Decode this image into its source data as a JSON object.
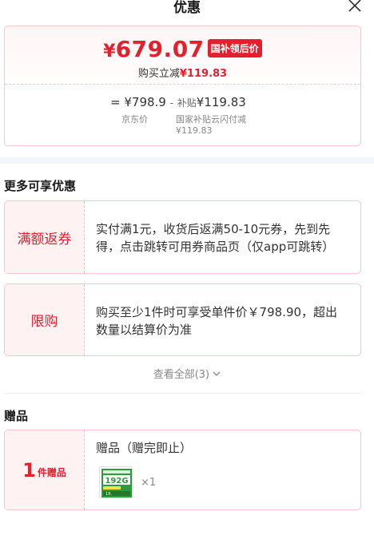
{
  "header": {
    "title": "优惠"
  },
  "price": {
    "currency": "¥",
    "amount": "679.07",
    "tag": "国补领后价",
    "discount_prefix": "购买立减",
    "discount_value": "¥119.83"
  },
  "calc": {
    "equals": "=",
    "original": "¥798.9",
    "minus": "-",
    "subsidy_label": "补贴",
    "subsidy_value": "¥119.83",
    "original_label": "京东价",
    "subsidy_desc": "国家补贴云闪付减",
    "subsidy_desc_value": "¥119.83"
  },
  "more_promos": {
    "title": "更多可享优惠",
    "items": [
      {
        "tag": "满额返券",
        "text": "实付满1元，收货后返满50-10元券，先到先得，点击跳转可用券商品页（仅app可跳转）"
      },
      {
        "tag": "限购",
        "text": "购买至少1件时可享受单件价￥798.90，超出数量以结算价为准"
      }
    ],
    "see_all": "查看全部(3)",
    "see_all_icon": "chevron-down-icon"
  },
  "gift": {
    "title": "赠品",
    "count": "1",
    "count_label": "件赠品",
    "name": "赠品（赠完即止）",
    "thumb_text": "192G",
    "qty": "×1"
  },
  "colors": {
    "accent": "#e4202e",
    "card_border": "#f3c8cc",
    "tag_bg": "#fff2f3"
  }
}
